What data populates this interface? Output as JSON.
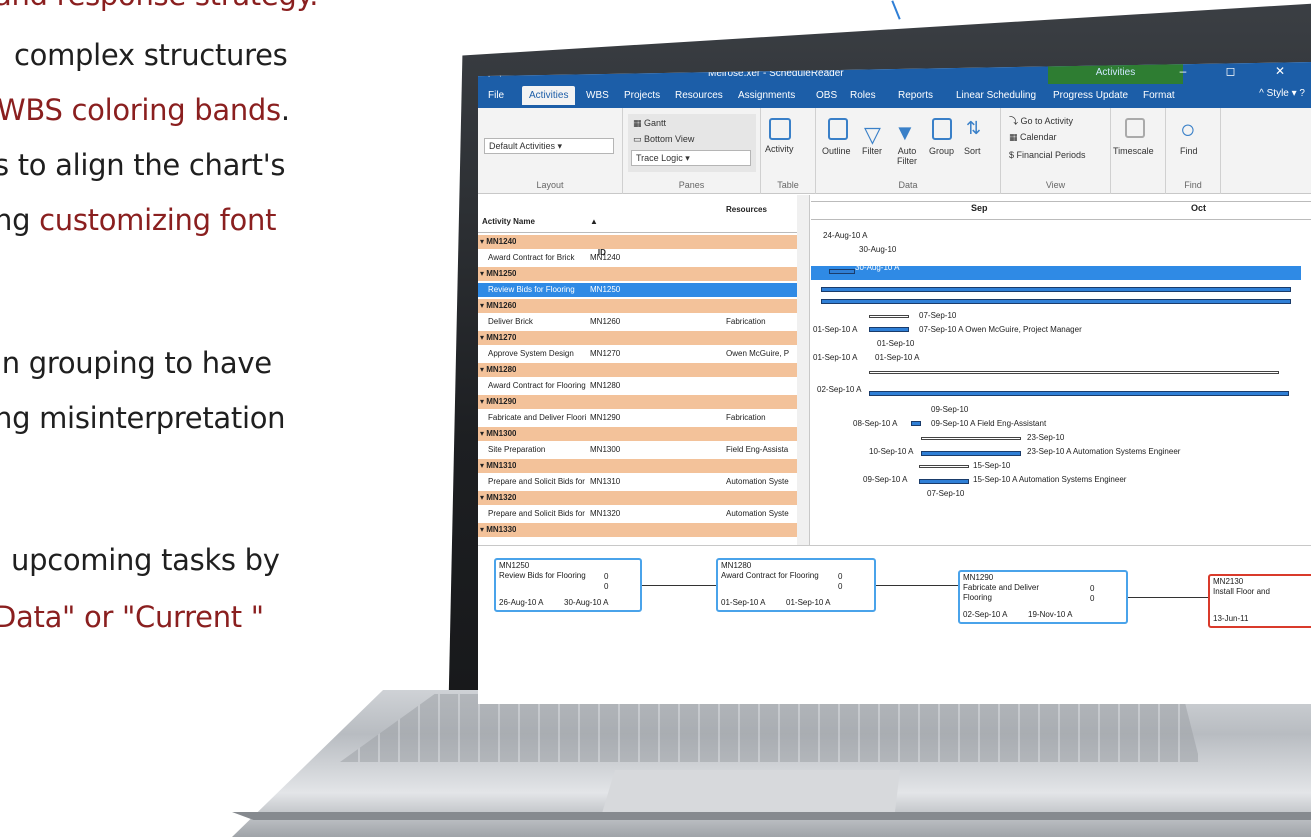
{
  "marketing": {
    "line1": "and response strategy.",
    "line2": "complex structures",
    "line3a": "WBS coloring bands",
    "line3b": ".",
    "line4": "s to align the chart's",
    "line5a": "ng ",
    "line5b": "customizing font",
    "line6": "in grouping to have",
    "line7": "ng misinterpretation",
    "line8": "upcoming tasks by",
    "line9": "Data\"   or   \"Current   \""
  },
  "window": {
    "title": "Melrose.xer - ScheduleReader",
    "context_tab": "Activities",
    "buttons": "–  ◻  ✕",
    "style_label": "^ Style ▾ ?"
  },
  "tabs": [
    "File",
    "Activities",
    "WBS",
    "Projects",
    "Resources",
    "Assignments",
    "OBS",
    "Roles",
    "Reports",
    "Linear Scheduling",
    "Progress Update",
    "Format"
  ],
  "ribbon": {
    "layout_select": "Default Activities",
    "layout_label": "Layout",
    "panes_gantt": "Gantt",
    "panes_bottom": "Bottom View",
    "panes_trace": "Trace Logic",
    "panes_label": "Panes",
    "activity_btn": "Activity",
    "table_label": "Table",
    "outline_btn": "Outline",
    "filter_btn": "Filter",
    "autofilter_btn": "Auto Filter",
    "group_btn": "Group",
    "sort_btn": "Sort",
    "data_label": "Data",
    "goto_btn": "Go to Activity",
    "calendar_btn": "Calendar",
    "financial_btn": "Financial Periods",
    "view_label": "View",
    "timescale_btn": "Timescale",
    "find_btn": "Find",
    "find_label": "Find"
  },
  "grid": {
    "headers": {
      "name": "Activity Name",
      "id": "Activity ID",
      "resources": "Resources"
    },
    "rows": [
      {
        "type": "grp",
        "name": "MN1240"
      },
      {
        "type": "act",
        "name": "Award Contract for Brick",
        "id": "MN1240",
        "res": ""
      },
      {
        "type": "grp",
        "name": "MN1250"
      },
      {
        "type": "sel",
        "name": "Review Bids for Flooring",
        "id": "MN1250",
        "res": ""
      },
      {
        "type": "grp",
        "name": "MN1260"
      },
      {
        "type": "act",
        "name": "Deliver Brick",
        "id": "MN1260",
        "res": "Fabrication"
      },
      {
        "type": "grp",
        "name": "MN1270"
      },
      {
        "type": "act",
        "name": "Approve System Design",
        "id": "MN1270",
        "res": "Owen McGuire, P"
      },
      {
        "type": "grp",
        "name": "MN1280"
      },
      {
        "type": "act",
        "name": "Award Contract for Flooring",
        "id": "MN1280",
        "res": ""
      },
      {
        "type": "grp",
        "name": "MN1290"
      },
      {
        "type": "act",
        "name": "Fabricate and Deliver Floori",
        "id": "MN1290",
        "res": "Fabrication"
      },
      {
        "type": "grp",
        "name": "MN1300"
      },
      {
        "type": "act",
        "name": "Site Preparation",
        "id": "MN1300",
        "res": "Field Eng-Assista"
      },
      {
        "type": "grp",
        "name": "MN1310"
      },
      {
        "type": "act",
        "name": "Prepare and Solicit Bids for",
        "id": "MN1310",
        "res": "Automation Syste"
      },
      {
        "type": "grp",
        "name": "MN1320"
      },
      {
        "type": "act",
        "name": "Prepare and Solicit Bids for",
        "id": "MN1320",
        "res": "Automation Syste"
      },
      {
        "type": "grp",
        "name": "MN1330"
      }
    ]
  },
  "gantt": {
    "month_sep": "Sep",
    "month_oct": "Oct",
    "labels": [
      "24-Aug-10 A",
      "30-Aug-10",
      "30-Aug-10 A",
      "07-Sep-10",
      "01-Sep-10 A",
      "07-Sep-10 A   Owen McGuire, Project Manager",
      "01-Sep-10",
      "01-Sep-10 A",
      "01-Sep-10 A",
      "02-Sep-10 A",
      "09-Sep-10",
      "08-Sep-10 A",
      "09-Sep-10 A   Field Eng-Assistant",
      "23-Sep-10",
      "10-Sep-10 A",
      "23-Sep-10 A   Automation Systems Engineer",
      "15-Sep-10",
      "09-Sep-10 A",
      "15-Sep-10 A   Automation Systems Engineer",
      "07-Sep-10"
    ]
  },
  "network": [
    {
      "id": "MN1250",
      "name": "Review Bids for Flooring",
      "v1": "0",
      "v2": "0",
      "start": "26-Aug-10 A",
      "finish": "30-Aug-10 A"
    },
    {
      "id": "MN1280",
      "name": "Award Contract for Flooring",
      "v1": "0",
      "v2": "0",
      "start": "01-Sep-10 A",
      "finish": "01-Sep-10 A"
    },
    {
      "id": "MN1290",
      "name": "Fabricate and Deliver",
      "name2": "Flooring",
      "v1": "0",
      "v2": "0",
      "start": "02-Sep-10 A",
      "finish": "19-Nov-10 A"
    },
    {
      "id": "MN2130",
      "name": "Install Floor and",
      "start": "13-Jun-11"
    }
  ]
}
